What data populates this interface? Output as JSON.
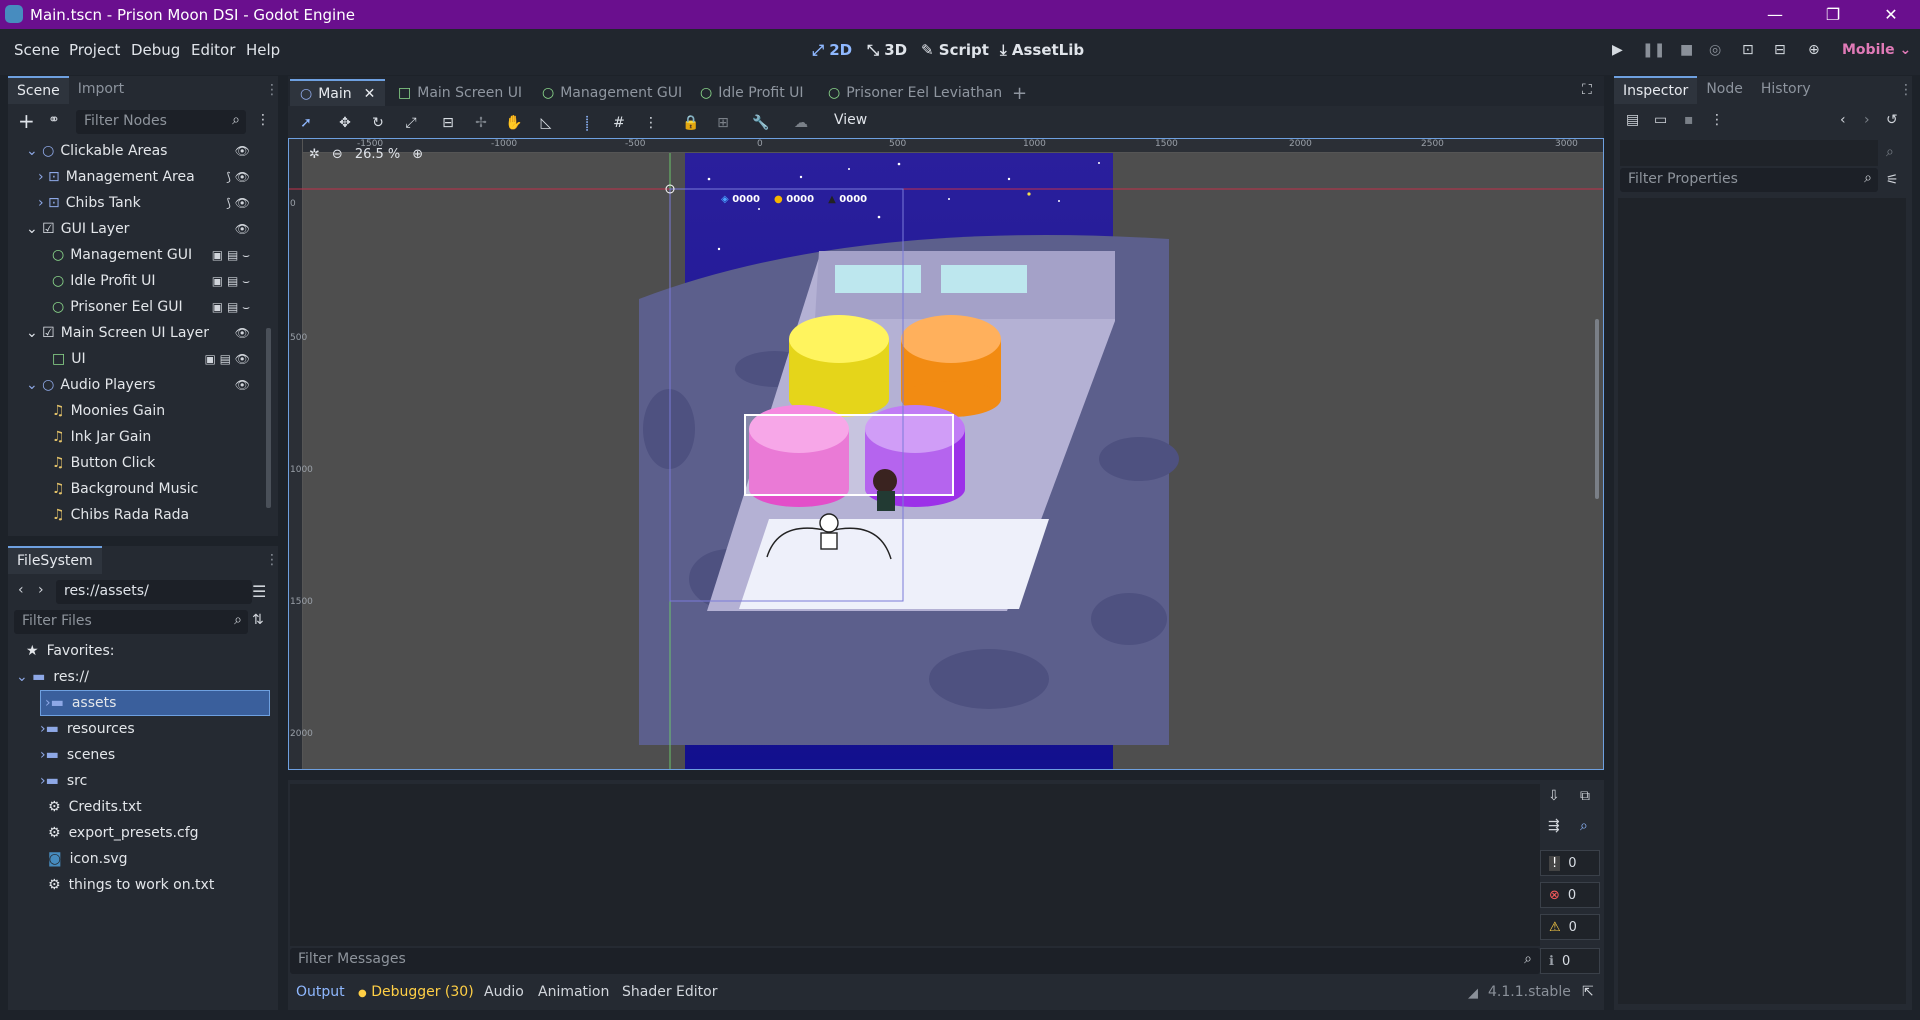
{
  "window": {
    "title": "Main.tscn - Prison Moon DSI - Godot Engine",
    "controls": [
      "—",
      "❐",
      "✕"
    ]
  },
  "menu": [
    "Scene",
    "Project",
    "Debug",
    "Editor",
    "Help"
  ],
  "workspaces": [
    {
      "label": "2D",
      "active": true
    },
    {
      "label": "3D",
      "active": false
    },
    {
      "label": "Script",
      "active": false
    },
    {
      "label": "AssetLib",
      "active": false
    }
  ],
  "renderer": "Mobile",
  "scene_dock": {
    "tabs": [
      "Scene",
      "Import"
    ],
    "filter_placeholder": "Filter Nodes",
    "nodes": [
      {
        "label": "Clickable Areas",
        "depth": 0
      },
      {
        "label": "Management Area",
        "depth": 1
      },
      {
        "label": "Chibs Tank",
        "depth": 1
      },
      {
        "label": "GUI Layer",
        "depth": 0
      },
      {
        "label": "Management GUI",
        "depth": 1
      },
      {
        "label": "Idle Profit UI",
        "depth": 1
      },
      {
        "label": "Prisoner Eel GUI",
        "depth": 1
      },
      {
        "label": "Main Screen UI Layer",
        "depth": 0
      },
      {
        "label": "UI",
        "depth": 1
      },
      {
        "label": "Audio Players",
        "depth": 0
      },
      {
        "label": "Moonies Gain",
        "depth": 1
      },
      {
        "label": "Ink Jar Gain",
        "depth": 1
      },
      {
        "label": "Button Click",
        "depth": 1
      },
      {
        "label": "Background Music",
        "depth": 1
      },
      {
        "label": "Chibs Rada Rada",
        "depth": 1
      }
    ]
  },
  "filesystem": {
    "title": "FileSystem",
    "path": "res://assets/",
    "filter_placeholder": "Filter Files",
    "favorites": "Favorites:",
    "root": "res://",
    "items": [
      {
        "label": "assets",
        "type": "folder",
        "selected": true
      },
      {
        "label": "resources",
        "type": "folder"
      },
      {
        "label": "scenes",
        "type": "folder"
      },
      {
        "label": "src",
        "type": "folder"
      },
      {
        "label": "Credits.txt",
        "type": "file"
      },
      {
        "label": "export_presets.cfg",
        "type": "file"
      },
      {
        "label": "icon.svg",
        "type": "svg"
      },
      {
        "label": "things to work on.txt",
        "type": "file"
      }
    ]
  },
  "editor_tabs": [
    {
      "label": "Main",
      "active": true
    },
    {
      "label": "Main Screen UI"
    },
    {
      "label": "Management GUI"
    },
    {
      "label": "Idle Profit UI"
    },
    {
      "label": "Prisoner Eel Leviathan"
    }
  ],
  "viewport": {
    "view_menu": "View",
    "zoom": "26.5 %",
    "ruler_h": [
      "-1500",
      "-1000",
      "-500",
      "0",
      "500",
      "1000",
      "1500",
      "2000",
      "2500",
      "3000"
    ],
    "ruler_v": [
      "0",
      "500",
      "1000",
      "1500",
      "2000"
    ],
    "hud_values": [
      "0000",
      "0000",
      "0000"
    ]
  },
  "inspector": {
    "tabs": [
      "Inspector",
      "Node",
      "History"
    ],
    "filter_placeholder": "Filter Properties"
  },
  "output": {
    "filter_placeholder": "Filter Messages",
    "counts": [
      "0",
      "0",
      "0",
      "0"
    ],
    "tabs": [
      "Output",
      "Debugger (30)",
      "Audio",
      "Animation",
      "Shader Editor"
    ],
    "version": "4.1.1.stable"
  }
}
